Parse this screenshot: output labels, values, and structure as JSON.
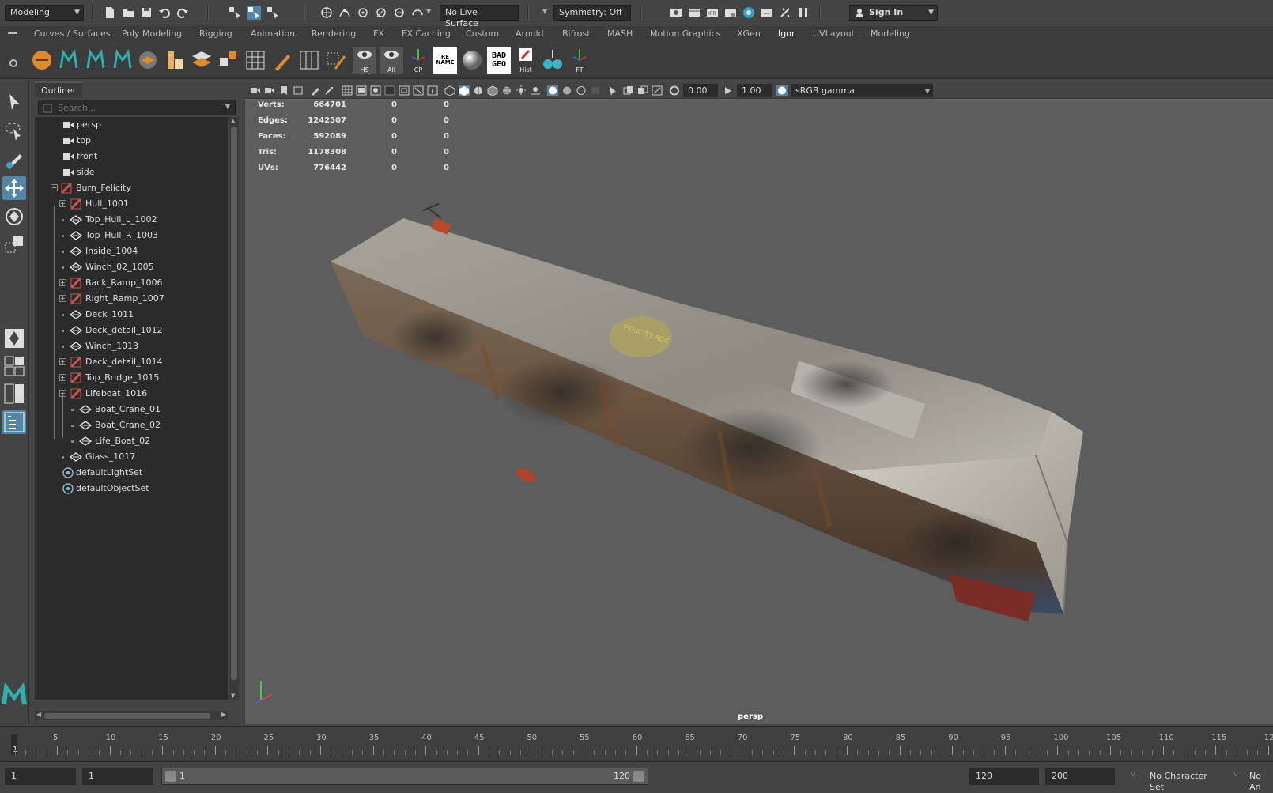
{
  "status_line": {
    "menu_set": "Modeling",
    "live_surface": "No Live Surface",
    "symmetry": "Symmetry: Off",
    "sign_in": "Sign In"
  },
  "shelf_tabs": [
    "Curves / Surfaces",
    "Poly Modeling",
    "Rigging",
    "Animation",
    "Rendering",
    "FX",
    "FX Caching",
    "Custom",
    "Arnold",
    "Bifrost",
    "MASH",
    "Motion Graphics",
    "XGen",
    "Igor",
    "UVLayout",
    "Modeling"
  ],
  "active_shelf_tab": "Igor",
  "shelf_buttons": {
    "hs": "HS",
    "all": "All",
    "cp": "CP",
    "rename": "RE NAME",
    "badgeo": "BAD GEO",
    "hist": "Hist",
    "ft": "FT"
  },
  "outliner": {
    "title": "Outliner",
    "search_placeholder": "Search...",
    "items": [
      "persp",
      "top",
      "front",
      "side",
      "Burn_Felicity",
      "Hull_1001",
      "Top_Hull_L_1002",
      "Top_Hull_R_1003",
      "Inside_1004",
      "Winch_02_1005",
      "Back_Ramp_1006",
      "Right_Ramp_1007",
      "Deck_1011",
      "Deck_detail_1012",
      "Winch_1013",
      "Deck_detail_1014",
      "Top_Bridge_1015",
      "Lifeboat_1016",
      "Boat_Crane_01",
      "Boat_Crane_02",
      "Life_Boat_02",
      "Glass_1017",
      "defaultLightSet",
      "defaultObjectSet"
    ]
  },
  "viewport_toolbar": {
    "exposure": "0.00",
    "gamma": "1.00",
    "color_space": "sRGB gamma"
  },
  "hud": {
    "rows": [
      {
        "label": "Verts:",
        "v1": "664701",
        "v2": "0",
        "v3": "0"
      },
      {
        "label": "Edges:",
        "v1": "1242507",
        "v2": "0",
        "v3": "0"
      },
      {
        "label": "Faces:",
        "v1": "592089",
        "v2": "0",
        "v3": "0"
      },
      {
        "label": "Tris:",
        "v1": "1178308",
        "v2": "0",
        "v3": "0"
      },
      {
        "label": "UVs:",
        "v1": "776442",
        "v2": "0",
        "v3": "0"
      }
    ]
  },
  "camera_label": "persp",
  "ship_deck_text": "FELICITY ACE",
  "time_slider": {
    "ticks": [
      "5",
      "10",
      "15",
      "20",
      "25",
      "30",
      "35",
      "40",
      "45",
      "50",
      "55",
      "60",
      "65",
      "70",
      "75",
      "80",
      "85",
      "90",
      "95",
      "100",
      "105",
      "110",
      "115",
      "12"
    ],
    "current_frame": "1"
  },
  "range_slider": {
    "start": "1",
    "playback_start": "1",
    "range_start_label": "1",
    "range_end_label": "120",
    "playback_end": "120",
    "end": "200",
    "character_set": "No Character Set",
    "anim_layer": "No An"
  }
}
